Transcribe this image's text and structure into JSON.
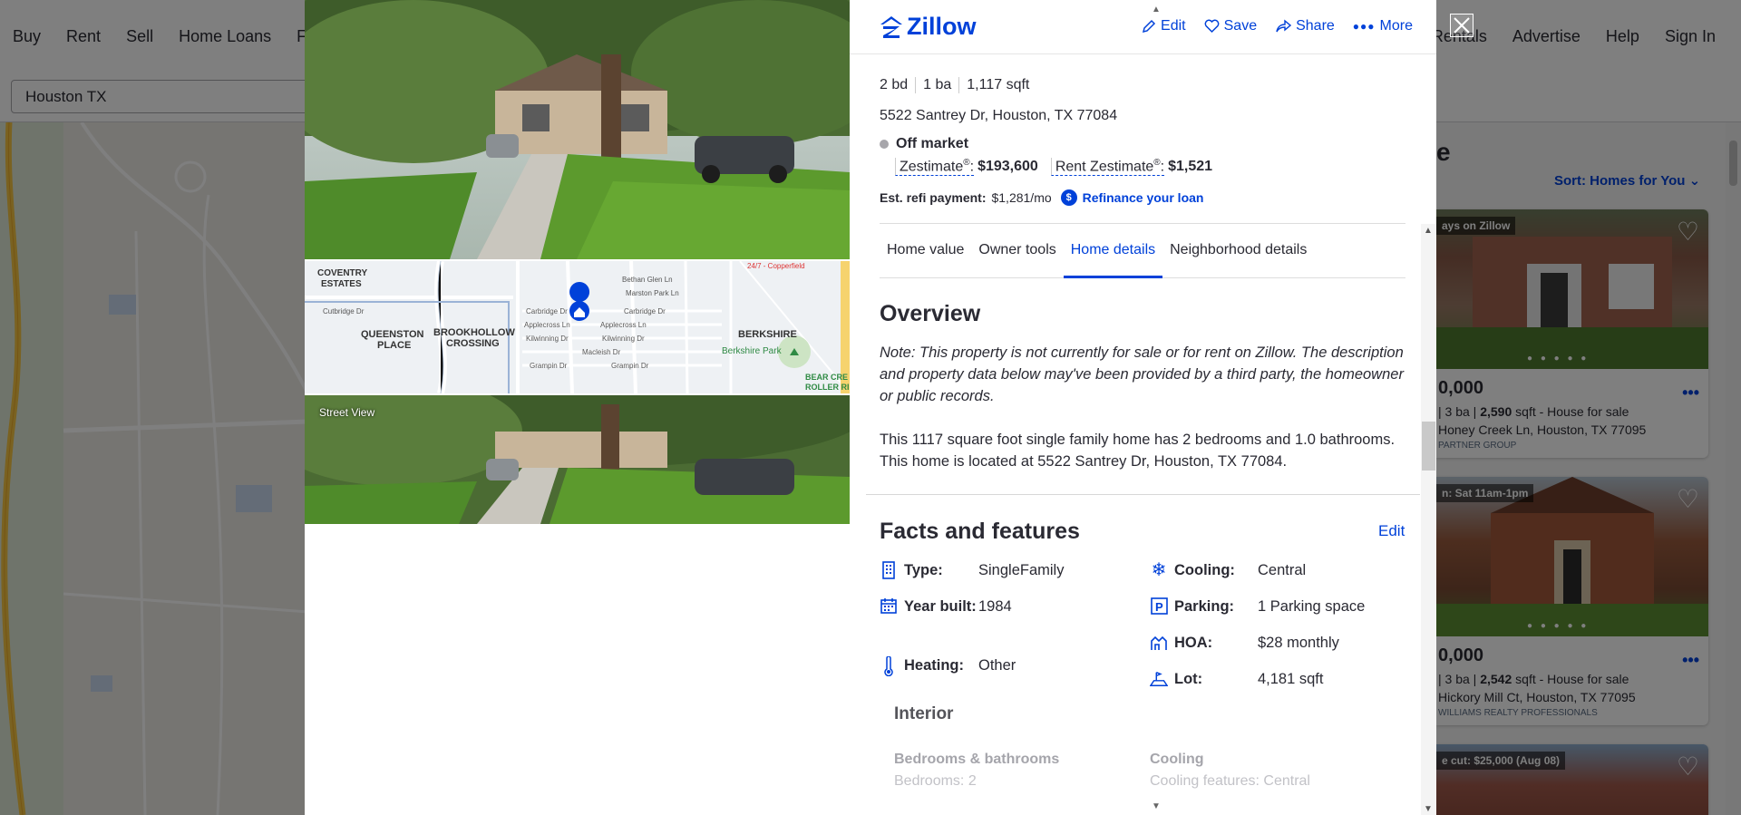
{
  "background": {
    "nav_left": [
      "Buy",
      "Rent",
      "Sell",
      "Home Loans",
      "Find"
    ],
    "nav_right": [
      "Rentals",
      "Advertise",
      "Help",
      "Sign In"
    ],
    "search_value": "Houston TX",
    "heading_fragment": "e",
    "sort_label": "Sort: Homes for You",
    "cards": [
      {
        "tag": "ays on Zillow",
        "price": "0,000",
        "ba": "3",
        "sqft": "2,590",
        "kind": " sqft - House for sale",
        "address": "Honey Creek Ln, Houston, TX 77095",
        "broker": "PARTNER GROUP"
      },
      {
        "tag": "n: Sat 11am-1pm",
        "price": "0,000",
        "ba": "3",
        "sqft": "2,542",
        "kind": " sqft - House for sale",
        "address": "Hickory Mill Ct, Houston, TX 77095",
        "broker": "WILLIAMS REALTY PROFESSIONALS"
      },
      {
        "tag": "e cut: $25,000 (Aug 08)"
      }
    ]
  },
  "header": {
    "logo": "Zillow",
    "actions": {
      "edit": "Edit",
      "save": "Save",
      "share": "Share",
      "more": "More"
    }
  },
  "media": {
    "street_view_label": "Street View",
    "map_labels": {
      "coventry": "COVENTRY",
      "estates": "ESTATES",
      "queenston": "QUEENSTON",
      "place": "PLACE",
      "brookhollow": "BROOKHOLLOW",
      "crossing": "CROSSING",
      "berkshire": "BERKSHIRE",
      "berkshire_park": "Berkshire Park",
      "bear_creek": "BEAR CRE",
      "roller": "ROLLER RI",
      "cutbridge": "Cutbridge Dr",
      "carbridge": "Carbridge Dr",
      "carbridge2": "Carbridge Dr",
      "applecross": "Applecross Ln",
      "applecross2": "Applecross Ln",
      "kilwinning": "Kilwinning Dr",
      "kilwinning2": "Kilwinning Dr",
      "macleish": "Macleish Dr",
      "grampin": "Grampin Dr",
      "grampin2": "Grampin Dr",
      "bethan": "Bethan Glen Ln",
      "marston": "Marston Park Ln",
      "copperfield": "24/7 - Copperfield"
    }
  },
  "summary": {
    "beds": "2 bd",
    "baths": "1 ba",
    "sqft": "1,117 sqft",
    "address": "5522 Santrey Dr, Houston, TX 77084",
    "status": "Off market",
    "zestimate_label": "Zestimate",
    "zestimate_value": "$193,600",
    "rent_label": "Rent Zestimate",
    "rent_value": "$1,521",
    "reg": "®",
    "refi_label": "Est. refi payment:",
    "refi_value": "$1,281/mo",
    "refi_link": "Refinance your loan"
  },
  "tabs": [
    "Home value",
    "Owner tools",
    "Home details",
    "Neighborhood details"
  ],
  "active_tab": "Home details",
  "overview": {
    "title": "Overview",
    "note": "Note: This property is not currently for sale or for rent on Zillow. The description and property data below may've been provided by a third party, the homeowner or public records.",
    "description": "This 1117 square foot single family home has 2 bedrooms and 1.0 bathrooms. This home is located at 5522 Santrey Dr, Houston, TX 77084."
  },
  "facts": {
    "title": "Facts and features",
    "edit": "Edit",
    "left": [
      {
        "icon": "building-icon",
        "label": "Type:",
        "value": "SingleFamily"
      },
      {
        "icon": "calendar-icon",
        "label": "Year built:",
        "value": "1984"
      },
      {
        "icon": "thermometer-icon",
        "label": "Heating:",
        "value": "Other"
      }
    ],
    "right": [
      {
        "icon": "snowflake-icon",
        "label": "Cooling:",
        "value": "Central"
      },
      {
        "icon": "parking-icon",
        "label": "Parking:",
        "value": "1 Parking space"
      },
      {
        "icon": "hoa-icon",
        "label": "HOA:",
        "value": "$28 monthly"
      },
      {
        "icon": "lot-icon",
        "label": "Lot:",
        "value": "4,181 sqft"
      }
    ],
    "interior": {
      "title": "Interior",
      "bed_bath_heading": "Bedrooms & bathrooms",
      "bedrooms": "Bedrooms: 2",
      "cooling_heading": "Cooling",
      "cooling_features": "Cooling features: Central"
    }
  },
  "colors": {
    "accent": "#0041d9",
    "text": "#2a2a33",
    "overlay": "rgba(0,0,0,0.5)"
  }
}
